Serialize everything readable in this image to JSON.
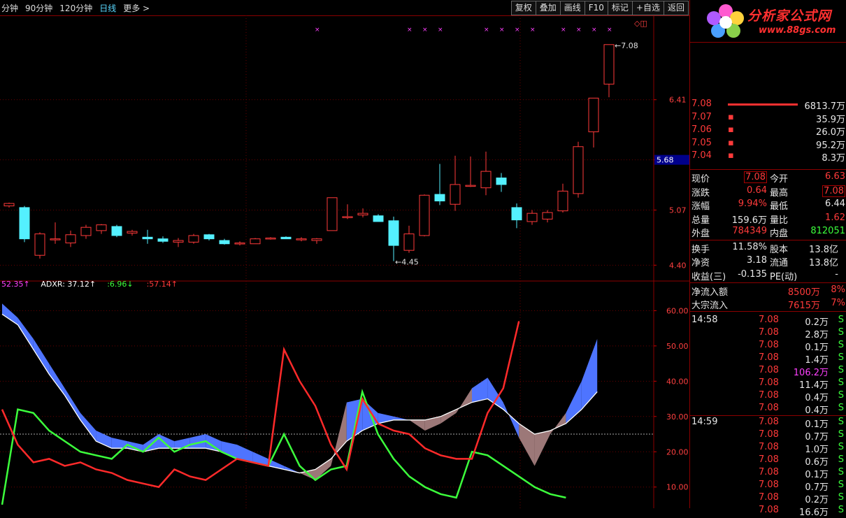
{
  "toolbar": {
    "periods": [
      {
        "label": "分钟",
        "active": false
      },
      {
        "label": "90分钟",
        "active": false
      },
      {
        "label": "120分钟",
        "active": false
      },
      {
        "label": "日线",
        "active": true
      },
      {
        "label": "更多 >",
        "active": false
      }
    ],
    "buttons": [
      "复权",
      "叠加",
      "画线",
      "F10",
      "标记",
      "+自选",
      "返回"
    ]
  },
  "logo": {
    "brand": "分析家公式网",
    "url": "www.88gs.com"
  },
  "main_chart": {
    "price_levels": [
      {
        "value": 6.41
      },
      {
        "value": 5.68,
        "highlight": true
      },
      {
        "value": 5.07
      },
      {
        "value": 4.4
      }
    ],
    "high_label": "7.08",
    "low_label": "4.45",
    "high_marker": "←7.08",
    "low_marker": "←4.45",
    "corner_icons": "◇◫"
  },
  "chart_data": [
    {
      "type": "candlestick",
      "title": "",
      "ylim": [
        4.25,
        7.35
      ],
      "y_ticks": [
        6.41,
        5.68,
        5.07,
        4.4
      ],
      "candles": [
        {
          "o": 5.12,
          "h": 5.16,
          "l": 5.1,
          "c": 5.15
        },
        {
          "o": 5.1,
          "h": 5.12,
          "l": 4.68,
          "c": 4.72
        },
        {
          "o": 4.52,
          "h": 4.8,
          "l": 4.48,
          "c": 4.78
        },
        {
          "o": 4.72,
          "h": 4.92,
          "l": 4.66,
          "c": 4.72
        },
        {
          "o": 4.67,
          "h": 4.82,
          "l": 4.62,
          "c": 4.77
        },
        {
          "o": 4.76,
          "h": 4.89,
          "l": 4.72,
          "c": 4.86
        },
        {
          "o": 4.82,
          "h": 4.9,
          "l": 4.78,
          "c": 4.89
        },
        {
          "o": 4.87,
          "h": 4.89,
          "l": 4.74,
          "c": 4.76
        },
        {
          "o": 4.79,
          "h": 4.83,
          "l": 4.76,
          "c": 4.81
        },
        {
          "o": 4.74,
          "h": 4.83,
          "l": 4.66,
          "c": 4.72
        },
        {
          "o": 4.72,
          "h": 4.75,
          "l": 4.67,
          "c": 4.69
        },
        {
          "o": 4.68,
          "h": 4.73,
          "l": 4.62,
          "c": 4.7
        },
        {
          "o": 4.68,
          "h": 4.78,
          "l": 4.66,
          "c": 4.76
        },
        {
          "o": 4.77,
          "h": 4.78,
          "l": 4.7,
          "c": 4.72
        },
        {
          "o": 4.7,
          "h": 4.72,
          "l": 4.65,
          "c": 4.66
        },
        {
          "o": 4.67,
          "h": 4.69,
          "l": 4.64,
          "c": 4.67
        },
        {
          "o": 4.66,
          "h": 4.73,
          "l": 4.66,
          "c": 4.72
        },
        {
          "o": 4.72,
          "h": 4.74,
          "l": 4.71,
          "c": 4.73
        },
        {
          "o": 4.74,
          "h": 4.75,
          "l": 4.72,
          "c": 4.72
        },
        {
          "o": 4.71,
          "h": 4.74,
          "l": 4.69,
          "c": 4.72
        },
        {
          "o": 4.7,
          "h": 4.73,
          "l": 4.66,
          "c": 4.72
        },
        {
          "o": 4.82,
          "h": 5.22,
          "l": 4.82,
          "c": 5.22
        },
        {
          "o": 4.99,
          "h": 5.14,
          "l": 4.96,
          "c": 4.99
        },
        {
          "o": 5.01,
          "h": 5.09,
          "l": 4.98,
          "c": 5.03
        },
        {
          "o": 5.0,
          "h": 5.02,
          "l": 4.93,
          "c": 4.93
        },
        {
          "o": 4.94,
          "h": 4.99,
          "l": 4.45,
          "c": 4.64
        },
        {
          "o": 4.58,
          "h": 4.88,
          "l": 4.55,
          "c": 4.78
        },
        {
          "o": 4.76,
          "h": 5.26,
          "l": 4.75,
          "c": 5.25
        },
        {
          "o": 5.26,
          "h": 5.63,
          "l": 5.13,
          "c": 5.18
        },
        {
          "o": 5.14,
          "h": 5.73,
          "l": 5.06,
          "c": 5.38
        },
        {
          "o": 5.37,
          "h": 5.72,
          "l": 5.35,
          "c": 5.37
        },
        {
          "o": 5.34,
          "h": 5.78,
          "l": 5.25,
          "c": 5.54
        },
        {
          "o": 5.46,
          "h": 5.52,
          "l": 5.29,
          "c": 5.38
        },
        {
          "o": 5.1,
          "h": 5.15,
          "l": 4.85,
          "c": 4.95
        },
        {
          "o": 4.93,
          "h": 5.07,
          "l": 4.89,
          "c": 5.03
        },
        {
          "o": 4.96,
          "h": 5.07,
          "l": 4.92,
          "c": 5.04
        },
        {
          "o": 5.06,
          "h": 5.39,
          "l": 5.04,
          "c": 5.3
        },
        {
          "o": 5.27,
          "h": 5.9,
          "l": 5.22,
          "c": 5.84
        },
        {
          "o": 6.02,
          "h": 6.43,
          "l": 5.83,
          "c": 6.43
        },
        {
          "o": 6.6,
          "h": 7.08,
          "l": 6.44,
          "c": 7.08
        }
      ],
      "signal_marks": [
        20,
        26,
        27,
        28,
        31,
        32,
        33,
        34,
        36,
        37,
        38,
        39
      ]
    },
    {
      "type": "line",
      "title": "ADXR",
      "ylim": [
        4,
        68
      ],
      "y_ticks": [
        60,
        50,
        40,
        30,
        20,
        10
      ],
      "legend": [
        {
          "text": "52.35↑",
          "color": "#ff40ff"
        },
        {
          "text": "ADXR: 37.12↑",
          "color": "#ffffff"
        },
        {
          "text": ":6.96↓",
          "color": "#3cff3c"
        },
        {
          "text": ":57.14↑",
          "color": "#ff3a3a"
        }
      ],
      "baseline": 25,
      "series": [
        {
          "name": "ADX",
          "color": "#ffffff",
          "values": [
            59,
            56,
            49,
            42,
            36,
            29,
            23,
            21,
            21,
            20,
            21,
            21,
            21,
            21,
            20,
            18,
            17,
            16,
            15,
            14,
            15,
            18,
            23,
            26,
            28,
            29,
            29,
            29,
            30,
            32,
            34,
            35,
            32,
            28,
            25,
            26,
            28,
            32,
            37
          ]
        },
        {
          "name": "ADXR",
          "color": "#ffffff",
          "values": [
            62,
            58,
            52,
            45,
            38,
            31,
            26,
            24,
            23,
            22,
            25,
            23,
            24,
            25,
            23,
            22,
            20,
            18,
            16,
            14,
            12,
            16,
            34,
            35,
            31,
            30,
            29,
            26,
            28,
            31,
            38,
            41,
            34,
            24,
            16,
            25,
            31,
            40,
            52
          ]
        },
        {
          "name": "+DI",
          "color": "#3cff3c",
          "values": [
            5,
            32,
            31,
            26,
            23,
            20,
            19,
            18,
            22,
            20,
            24,
            20,
            22,
            23,
            20,
            18,
            17,
            16,
            25,
            16,
            12,
            15,
            16,
            37,
            25,
            18,
            13,
            10,
            8,
            7,
            20,
            19,
            16,
            13,
            10,
            8,
            7
          ]
        },
        {
          "name": "-DI",
          "color": "#ff3a3a",
          "values": [
            32,
            22,
            17,
            18,
            16,
            17,
            15,
            14,
            12,
            11,
            10,
            15,
            13,
            12,
            15,
            18,
            17,
            16,
            49,
            40,
            33,
            22,
            15,
            35,
            28,
            26,
            25,
            21,
            19,
            18,
            18,
            31,
            38,
            57
          ]
        }
      ]
    }
  ],
  "side": {
    "order_book": [
      {
        "price": "7.08",
        "vol": "6813.7万",
        "bar": true
      },
      {
        "price": "7.07",
        "vol": "35.9万"
      },
      {
        "price": "7.06",
        "vol": "26.0万"
      },
      {
        "price": "7.05",
        "vol": "95.2万"
      },
      {
        "price": "7.04",
        "vol": "8.3万"
      }
    ],
    "quote": [
      {
        "l1": "现价",
        "v1": "7.08",
        "c1": "red",
        "box1": true,
        "l2": "今开",
        "v2": "6.63",
        "c2": "red"
      },
      {
        "l1": "涨跌",
        "v1": "0.64",
        "c1": "red",
        "l2": "最高",
        "v2": "7.08",
        "c2": "red",
        "box2": true
      },
      {
        "l1": "涨幅",
        "v1": "9.94%",
        "c1": "red",
        "l2": "最低",
        "v2": "6.44",
        "c2": "white"
      },
      {
        "l1": "总量",
        "v1": "159.6万",
        "c1": "white",
        "l2": "量比",
        "v2": "1.62",
        "c2": "red"
      },
      {
        "l1": "外盘",
        "v1": "784349",
        "c1": "red",
        "l2": "内盘",
        "v2": "812051",
        "c2": "green"
      }
    ],
    "stats": [
      {
        "l1": "换手",
        "v1": "11.58%",
        "l2": "股本",
        "v2": "13.8亿"
      },
      {
        "l1": "净资",
        "v1": "3.18",
        "l2": "流通",
        "v2": "13.8亿"
      },
      {
        "l1": "收益(三)",
        "v1": "-0.135",
        "l2": "PE(动)",
        "v2": "-"
      }
    ],
    "flows": [
      {
        "label": "净流入额",
        "value": "8500万",
        "pct": "8%"
      },
      {
        "label": "大宗流入",
        "value": "7615万",
        "pct": "7%"
      }
    ],
    "ticks": [
      {
        "time": "14:58",
        "price": "7.08",
        "vol": "0.2万",
        "side": "S"
      },
      {
        "time": "",
        "price": "7.08",
        "vol": "2.8万",
        "side": "S"
      },
      {
        "time": "",
        "price": "7.08",
        "vol": "0.1万",
        "side": "S"
      },
      {
        "time": "",
        "price": "7.08",
        "vol": "1.4万",
        "side": "S"
      },
      {
        "time": "",
        "price": "7.08",
        "vol": "106.2万",
        "side": "S",
        "big": true
      },
      {
        "time": "",
        "price": "7.08",
        "vol": "11.4万",
        "side": "S"
      },
      {
        "time": "",
        "price": "7.08",
        "vol": "0.4万",
        "side": "S"
      },
      {
        "time": "",
        "price": "7.08",
        "vol": "0.4万",
        "side": "S"
      },
      {
        "time": "14:59",
        "price": "7.08",
        "vol": "0.1万",
        "side": "S"
      },
      {
        "time": "",
        "price": "7.08",
        "vol": "0.7万",
        "side": "S"
      },
      {
        "time": "",
        "price": "7.08",
        "vol": "1.0万",
        "side": "S"
      },
      {
        "time": "",
        "price": "7.08",
        "vol": "0.6万",
        "side": "S"
      },
      {
        "time": "",
        "price": "7.08",
        "vol": "0.1万",
        "side": "S"
      },
      {
        "time": "",
        "price": "7.08",
        "vol": "0.7万",
        "side": "S"
      },
      {
        "time": "",
        "price": "7.08",
        "vol": "0.2万",
        "side": "S"
      },
      {
        "time": "",
        "price": "7.08",
        "vol": "16.6万",
        "side": "S"
      }
    ]
  }
}
